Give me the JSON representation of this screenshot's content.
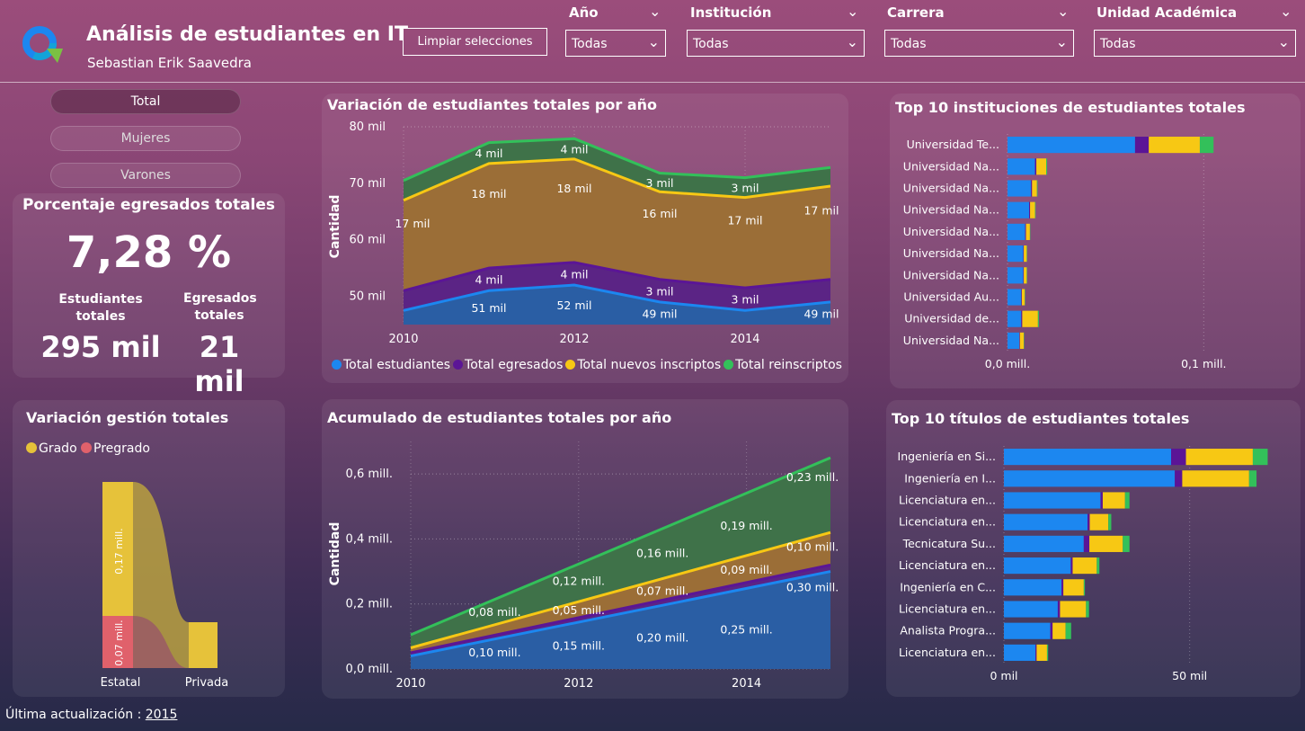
{
  "header": {
    "title": "Análisis de estudiantes en IT",
    "subtitle": "Sebastian Erik Saavedra",
    "clear_button": "Limpiar selecciones"
  },
  "filters": [
    {
      "label": "Año",
      "value": "Todas"
    },
    {
      "label": "Institución",
      "value": "Todas"
    },
    {
      "label": "Carrera",
      "value": "Todas"
    },
    {
      "label": "Unidad Académica",
      "value": "Todas"
    }
  ],
  "segment": {
    "total": "Total",
    "women": "Mujeres",
    "men": "Varones",
    "active": "Total"
  },
  "kpi": {
    "title": "Porcentaje egresados totales",
    "percent": "7,28 %",
    "students_label": "Estudiantes totales",
    "students_value": "295 mil",
    "grads_label": "Egresados totales",
    "grads_value": "21 mil"
  },
  "colors": {
    "students": "#1c87f0",
    "grads": "#5b1596",
    "new": "#f7c814",
    "reenrolled": "#33c05a",
    "grado": "#e6c23a",
    "pregrado": "#e0616b"
  },
  "footer": {
    "label": "Última actualización :",
    "year": "2015"
  },
  "chart_data": [
    {
      "type": "area",
      "title": "Variación de estudiantes totales por año",
      "ylabel": "Cantidad",
      "unit": "mil",
      "x": [
        2010,
        2011,
        2012,
        2013,
        2014,
        2015
      ],
      "ylim": [
        45,
        80
      ],
      "yticks": [
        {
          "v": 50,
          "label": "50 mil"
        },
        {
          "v": 60,
          "label": "60 mil"
        },
        {
          "v": 70,
          "label": "70 mil"
        },
        {
          "v": 80,
          "label": "80 mil"
        }
      ],
      "xticks": [
        {
          "v": 2010,
          "label": "2010"
        },
        {
          "v": 2012,
          "label": "2012"
        },
        {
          "v": 2014,
          "label": "2014"
        }
      ],
      "series": [
        {
          "name": "Total estudiantes",
          "values": [
            47.5,
            51,
            52,
            49,
            47.5,
            49
          ],
          "color": "#1c87f0",
          "labels": [
            "",
            "51 mil",
            "52 mil",
            "49 mil",
            "",
            "49 mil"
          ]
        },
        {
          "name": "Total egresados",
          "values": [
            51,
            55,
            56,
            53,
            51.5,
            53
          ],
          "color": "#5b1596",
          "labels": [
            "",
            "4 mil",
            "4 mil",
            "3 mil",
            "3 mil",
            ""
          ]
        },
        {
          "name": "Total nuevos inscriptos",
          "values": [
            67,
            73.5,
            74.3,
            68.5,
            67.5,
            69.5
          ],
          "color": "#f7c814",
          "labels": [
            "17 mil",
            "18 mil",
            "18 mil",
            "16 mil",
            "17 mil",
            "17 mil"
          ]
        },
        {
          "name": "Total reinscriptos",
          "values": [
            70.5,
            77.2,
            77.9,
            71.8,
            71,
            72.8
          ],
          "color": "#33c05a",
          "labels": [
            "",
            "4 mil",
            "4 mil",
            "3 mil",
            "3 mil",
            ""
          ]
        }
      ]
    },
    {
      "type": "area",
      "title": "Acumulado de estudiantes totales por año",
      "ylabel": "Cantidad",
      "unit": "mill.",
      "x": [
        2010,
        2015
      ],
      "ylim": [
        0,
        0.7
      ],
      "yticks": [
        {
          "v": 0,
          "label": "0,0 mill."
        },
        {
          "v": 0.2,
          "label": "0,2 mill."
        },
        {
          "v": 0.4,
          "label": "0,4 mill."
        },
        {
          "v": 0.6,
          "label": "0,6 mill."
        }
      ],
      "xticks": [
        {
          "v": 2010,
          "label": "2010"
        },
        {
          "v": 2012,
          "label": "2012"
        },
        {
          "v": 2014,
          "label": "2014"
        }
      ],
      "series": [
        {
          "name": "Total estudiantes",
          "values": [
            0.04,
            0.3
          ],
          "color": "#1c87f0"
        },
        {
          "name": "Total egresados",
          "values": [
            0.05,
            0.32
          ],
          "color": "#5b1596"
        },
        {
          "name": "Total nuevos inscriptos",
          "values": [
            0.065,
            0.42
          ],
          "color": "#f7c814"
        },
        {
          "name": "Total reinscriptos",
          "values": [
            0.105,
            0.65
          ],
          "color": "#33c05a"
        }
      ],
      "annotations": [
        {
          "x": 2011,
          "y": 0.05,
          "text": "0,10 mill."
        },
        {
          "x": 2012,
          "y": 0.07,
          "text": "0,15 mill."
        },
        {
          "x": 2013,
          "y": 0.095,
          "text": "0,20 mill."
        },
        {
          "x": 2014,
          "y": 0.12,
          "text": "0,25 mill."
        },
        {
          "x": 2015,
          "y": 0.25,
          "text": "0,30 mill."
        },
        {
          "x": 2012,
          "y": 0.18,
          "text": "0,05 mill."
        },
        {
          "x": 2013,
          "y": 0.24,
          "text": "0,07 mill."
        },
        {
          "x": 2014,
          "y": 0.305,
          "text": "0,09 mill."
        },
        {
          "x": 2015,
          "y": 0.375,
          "text": "0,10 mill."
        },
        {
          "x": 2011,
          "y": 0.175,
          "text": "0,08 mill."
        },
        {
          "x": 2012,
          "y": 0.27,
          "text": "0,12 mill."
        },
        {
          "x": 2013,
          "y": 0.355,
          "text": "0,16 mill."
        },
        {
          "x": 2014,
          "y": 0.44,
          "text": "0,19 mill."
        },
        {
          "x": 2015,
          "y": 0.59,
          "text": "0,23 mill."
        }
      ]
    },
    {
      "type": "bar",
      "orientation": "horizontal",
      "stacked": true,
      "title": "Top 10 instituciones de estudiantes totales",
      "categories": [
        "Universidad Te...",
        "Universidad Na...",
        "Universidad Na...",
        "Universidad Na...",
        "Universidad Na...",
        "Universidad Na...",
        "Universidad Na...",
        "Universidad Au...",
        "Universidad de...",
        "Universidad Na..."
      ],
      "xlim": [
        0,
        0.12
      ],
      "xticks": [
        {
          "v": 0,
          "label": "0,0 mill."
        },
        {
          "v": 0.1,
          "label": "0,1 mill."
        }
      ],
      "series": [
        {
          "name": "Total estudiantes",
          "values": [
            0.065,
            0.014,
            0.012,
            0.011,
            0.009,
            0.008,
            0.008,
            0.007,
            0.007,
            0.006
          ]
        },
        {
          "name": "Total egresados",
          "values": [
            0.007,
            0.0007,
            0.0005,
            0.0005,
            0.0004,
            0.0003,
            0.0003,
            0.0003,
            0.0005,
            0.0003
          ]
        },
        {
          "name": "Total nuevos inscriptos",
          "values": [
            0.026,
            0.005,
            0.0025,
            0.0025,
            0.002,
            0.0015,
            0.0015,
            0.0015,
            0.008,
            0.002
          ]
        },
        {
          "name": "Total reinscriptos",
          "values": [
            0.007,
            0.0005,
            0.0003,
            0.0003,
            0.0002,
            0.0002,
            0.0002,
            0.0002,
            0.0005,
            0.0002
          ]
        }
      ]
    },
    {
      "type": "bar",
      "orientation": "horizontal",
      "stacked": true,
      "title": "Top 10 títulos de estudiantes totales",
      "categories": [
        "Ingeniería en Si...",
        "Ingeniería en I...",
        "Licenciatura en...",
        "Licenciatura en...",
        "Tecnicatura Su...",
        "Licenciatura en...",
        "Ingeniería en C...",
        "Licenciatura en...",
        "Analista Progra...",
        "Licenciatura en..."
      ],
      "xlim": [
        0,
        75
      ],
      "xticks": [
        {
          "v": 0,
          "label": "0 mil"
        },
        {
          "v": 50,
          "label": "50 mil"
        }
      ],
      "series": [
        {
          "name": "Total estudiantes",
          "values": [
            45,
            46,
            26,
            22.5,
            21.5,
            18,
            15.5,
            14.5,
            12.5,
            8.5
          ]
        },
        {
          "name": "Total egresados",
          "values": [
            4,
            2,
            0.6,
            0.6,
            1.5,
            0.5,
            0.5,
            0.6,
            0.6,
            0.3
          ]
        },
        {
          "name": "Total nuevos inscriptos",
          "values": [
            18,
            18,
            6,
            5,
            9,
            6.5,
            5.5,
            7,
            3.5,
            2.8
          ]
        },
        {
          "name": "Total reinscriptos",
          "values": [
            4,
            2,
            1.2,
            0.8,
            1.8,
            0.7,
            0.3,
            0.8,
            1.5,
            0.3
          ]
        }
      ]
    },
    {
      "type": "sankey",
      "title": "Variación gestión totales",
      "legend": [
        {
          "name": "Grado",
          "color": "#e6c23a"
        },
        {
          "name": "Pregrado",
          "color": "#e0616b"
        }
      ],
      "nodes": [
        {
          "name": "Estatal"
        },
        {
          "name": "Privada"
        }
      ],
      "flows": [
        {
          "from": "Estatal",
          "to": "Privada",
          "series": "Grado",
          "value": 0.17,
          "label": "0,17 mill."
        },
        {
          "from": "Estatal",
          "to": "Privada",
          "series": "Pregrado",
          "value": 0.07,
          "label": "0,07 mill."
        }
      ]
    }
  ]
}
